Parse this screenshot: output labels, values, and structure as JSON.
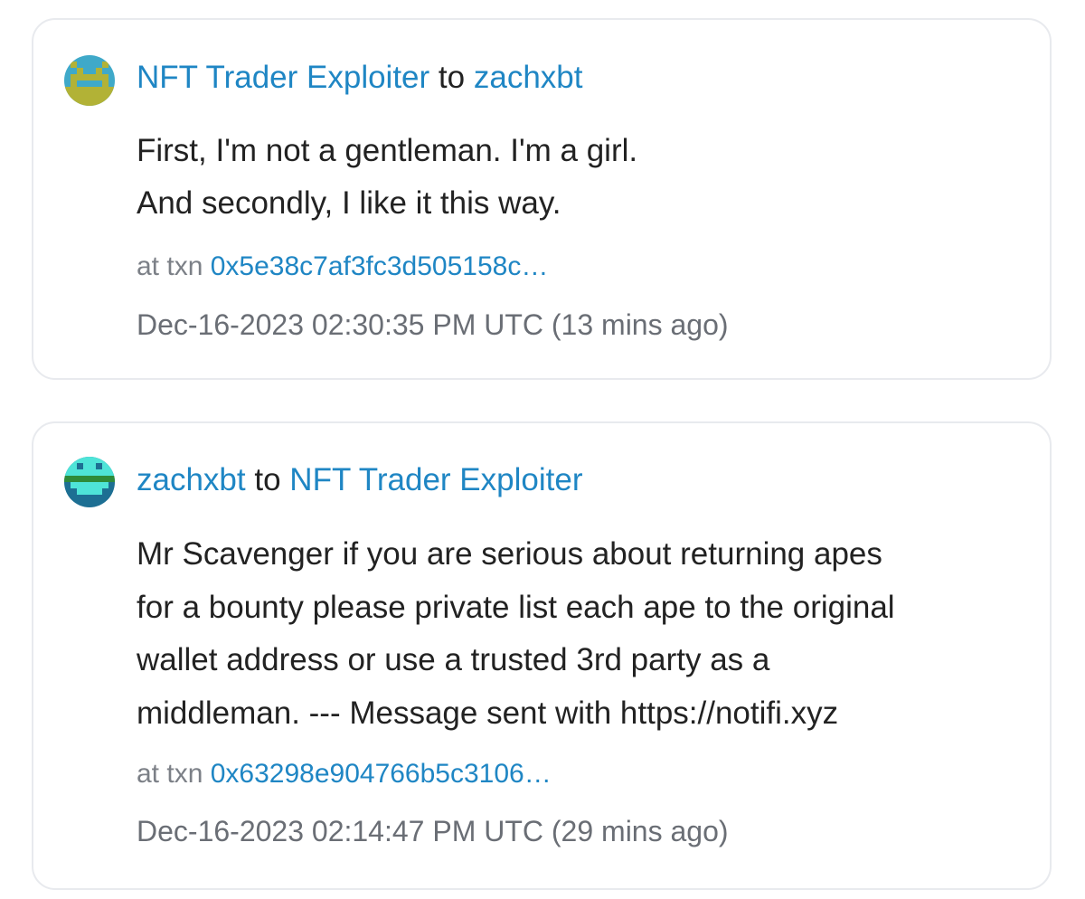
{
  "messages": [
    {
      "sender": "NFT Trader Exploiter",
      "connector": "to",
      "recipient": "zachxbt",
      "avatar_icon": "pixel-face-avatar-icon",
      "lines": [
        "First, I'm not a gentleman. I'm a girl.",
        "And secondly, I like it this way."
      ],
      "txn_prefix": "at txn",
      "txn_hash": "0x5e38c7af3fc3d505158c…",
      "timestamp": "Dec-16-2023 02:30:35 PM UTC",
      "relative_time": "(13 mins ago)"
    },
    {
      "sender": "zachxbt",
      "connector": "to",
      "recipient": "NFT Trader Exploiter",
      "avatar_icon": "pixel-face-avatar-icon",
      "lines": [
        "Mr Scavenger if you are serious about returning apes",
        "for a bounty please private list each ape to the original",
        "wallet address or use a trusted 3rd party as a",
        "middleman. --- Message sent with https://notifi.xyz"
      ],
      "txn_prefix": "at txn",
      "txn_hash": "0x63298e904766b5c3106…",
      "timestamp": "Dec-16-2023 02:14:47 PM UTC",
      "relative_time": "(29 mins ago)"
    }
  ],
  "colors": {
    "link": "#1f86c4",
    "text": "#222222",
    "muted": "#6a6e75",
    "card_border": "#e8eaee"
  }
}
